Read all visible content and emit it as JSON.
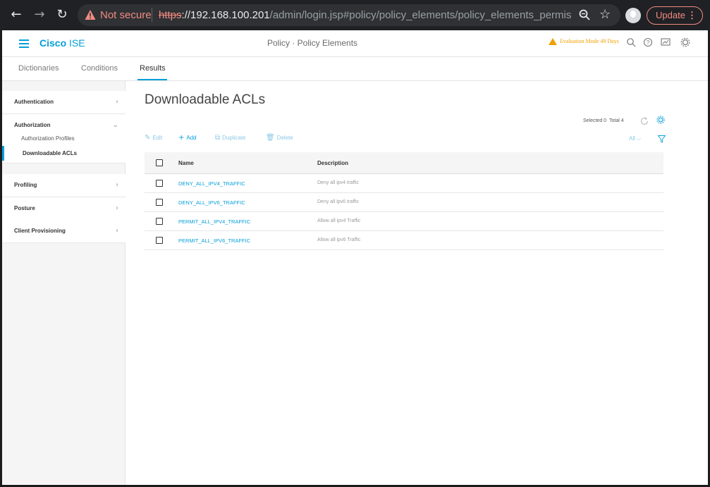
{
  "browser": {
    "security_label": "Not secure",
    "url_scheme": "https",
    "url_host": "://192.168.100.201",
    "url_path": "/admin/login.jsp#policy/policy_elements/policy_elements_permissions/...",
    "update_label": "Update",
    "update_dots": "⋮"
  },
  "header": {
    "brand_bold": "Cisco",
    "brand_light": "ISE",
    "page_title": "Policy · Policy Elements",
    "evaluation": "Evaluation Mode 49 Days"
  },
  "subnav": {
    "tabs": [
      {
        "label": "Dictionaries"
      },
      {
        "label": "Conditions"
      },
      {
        "label": "Results"
      }
    ]
  },
  "sidebar": {
    "authentication": "Authentication",
    "authorization": "Authorization",
    "authorization_profiles": "Authorization Profiles",
    "downloadable_acls": "Downloadable ACLs",
    "profiling": "Profiling",
    "posture": "Posture",
    "client_provisioning": "Client Provisioning"
  },
  "main": {
    "title": "Downloadable ACLs",
    "selected": "Selected 0",
    "total": "Total 4",
    "toolbar": {
      "edit": "Edit",
      "add": "Add",
      "duplicate": "Duplicate",
      "delete": "Delete",
      "filter_select": "All"
    },
    "table": {
      "headers": {
        "name": "Name",
        "description": "Description"
      },
      "rows": [
        {
          "name": "DENY_ALL_IPV4_TRAFFIC",
          "description": "Deny all ipv4 traffic"
        },
        {
          "name": "DENY_ALL_IPV6_TRAFFIC",
          "description": "Deny all ipv6 traffic"
        },
        {
          "name": "PERMIT_ALL_IPV4_TRAFFIC",
          "description": "Allow all ipv4 Traffic"
        },
        {
          "name": "PERMIT_ALL_IPV6_TRAFFIC",
          "description": "Allow all ipv6 Traffic"
        }
      ]
    }
  },
  "colors": {
    "accent": "#049fd9",
    "warning": "#f0a000",
    "chrome_bg": "#202124"
  }
}
